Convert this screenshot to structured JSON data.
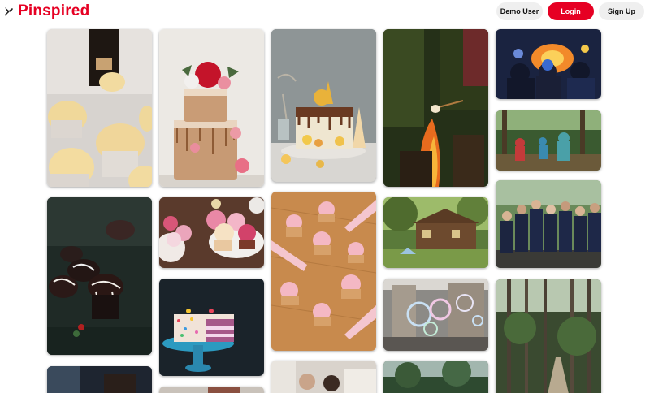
{
  "app": {
    "name": "Pinspired",
    "brand_color": "#e60023"
  },
  "header": {
    "logo_icon": "pin-icon",
    "buttons": {
      "demo_label": "Demo User",
      "login_label": "Login",
      "signup_label": "Sign Up"
    }
  },
  "pins": [
    {
      "name": "pin-cupcakes-bottle",
      "subject": "cupcakes with bottle"
    },
    {
      "name": "pin-naked-cake",
      "subject": "naked cake with flowers"
    },
    {
      "name": "pin-drip-cake",
      "subject": "drip cake with macarons"
    },
    {
      "name": "pin-campfire",
      "subject": "campfire marshmallow"
    },
    {
      "name": "pin-concert",
      "subject": "concert crowd"
    },
    {
      "name": "pin-hikers",
      "subject": "hikers in forest"
    },
    {
      "name": "pin-group-photo",
      "subject": "group photo"
    },
    {
      "name": "pin-chocolate-cupcakes",
      "subject": "chocolate cupcakes"
    },
    {
      "name": "pin-pink-cupcakes",
      "subject": "pink cupcakes"
    },
    {
      "name": "pin-piping-cupcakes",
      "subject": "piping cupcakes"
    },
    {
      "name": "pin-cabin",
      "subject": "cabin in woods"
    },
    {
      "name": "pin-sprinkle-cake",
      "subject": "sprinkle cake"
    },
    {
      "name": "pin-bubbles",
      "subject": "bubbles in city"
    },
    {
      "name": "pin-forest-path",
      "subject": "forest boardwalk"
    },
    {
      "name": "pin-partial-dark",
      "subject": "partial image"
    },
    {
      "name": "pin-partial-kitchen",
      "subject": "partial kitchen"
    },
    {
      "name": "pin-partial-forest",
      "subject": "partial forest"
    },
    {
      "name": "pin-partial-bottom",
      "subject": "partial image"
    }
  ]
}
